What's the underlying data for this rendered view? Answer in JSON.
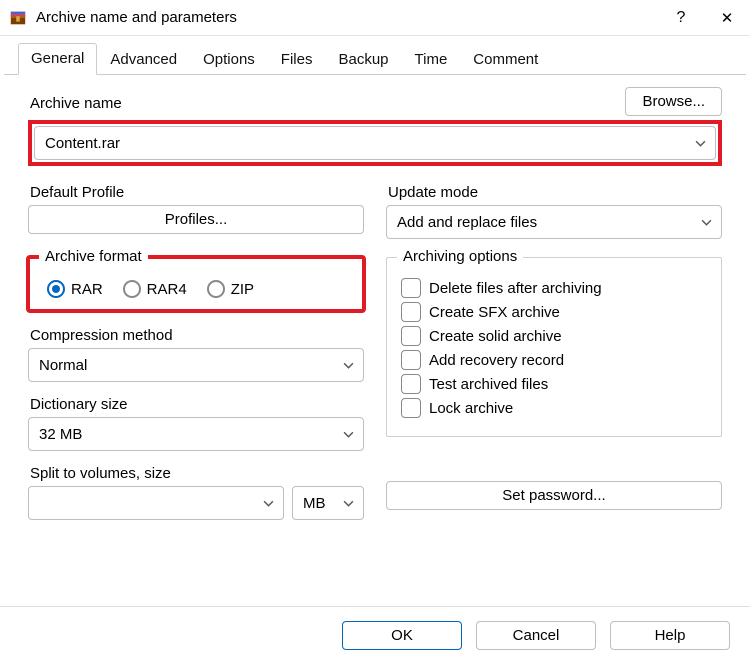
{
  "titlebar": {
    "title": "Archive name and parameters",
    "help_glyph": "?",
    "close_glyph": "✕"
  },
  "tabs": {
    "items": [
      "General",
      "Advanced",
      "Options",
      "Files",
      "Backup",
      "Time",
      "Comment"
    ],
    "active_index": 0
  },
  "archive_name": {
    "label": "Archive name",
    "value": "Content.rar",
    "browse": "Browse..."
  },
  "default_profile": {
    "label": "Default Profile",
    "button": "Profiles..."
  },
  "update_mode": {
    "label": "Update mode",
    "value": "Add and replace files"
  },
  "archive_format": {
    "legend": "Archive format",
    "options": [
      "RAR",
      "RAR4",
      "ZIP"
    ],
    "selected_index": 0
  },
  "archiving_options": {
    "legend": "Archiving options",
    "items": [
      "Delete files after archiving",
      "Create SFX archive",
      "Create solid archive",
      "Add recovery record",
      "Test archived files",
      "Lock archive"
    ]
  },
  "compression_method": {
    "label": "Compression method",
    "value": "Normal"
  },
  "dictionary_size": {
    "label": "Dictionary size",
    "value": "32 MB"
  },
  "split": {
    "label": "Split to volumes, size",
    "value": "",
    "unit": "MB"
  },
  "set_password": "Set password...",
  "footer": {
    "ok": "OK",
    "cancel": "Cancel",
    "help": "Help"
  }
}
